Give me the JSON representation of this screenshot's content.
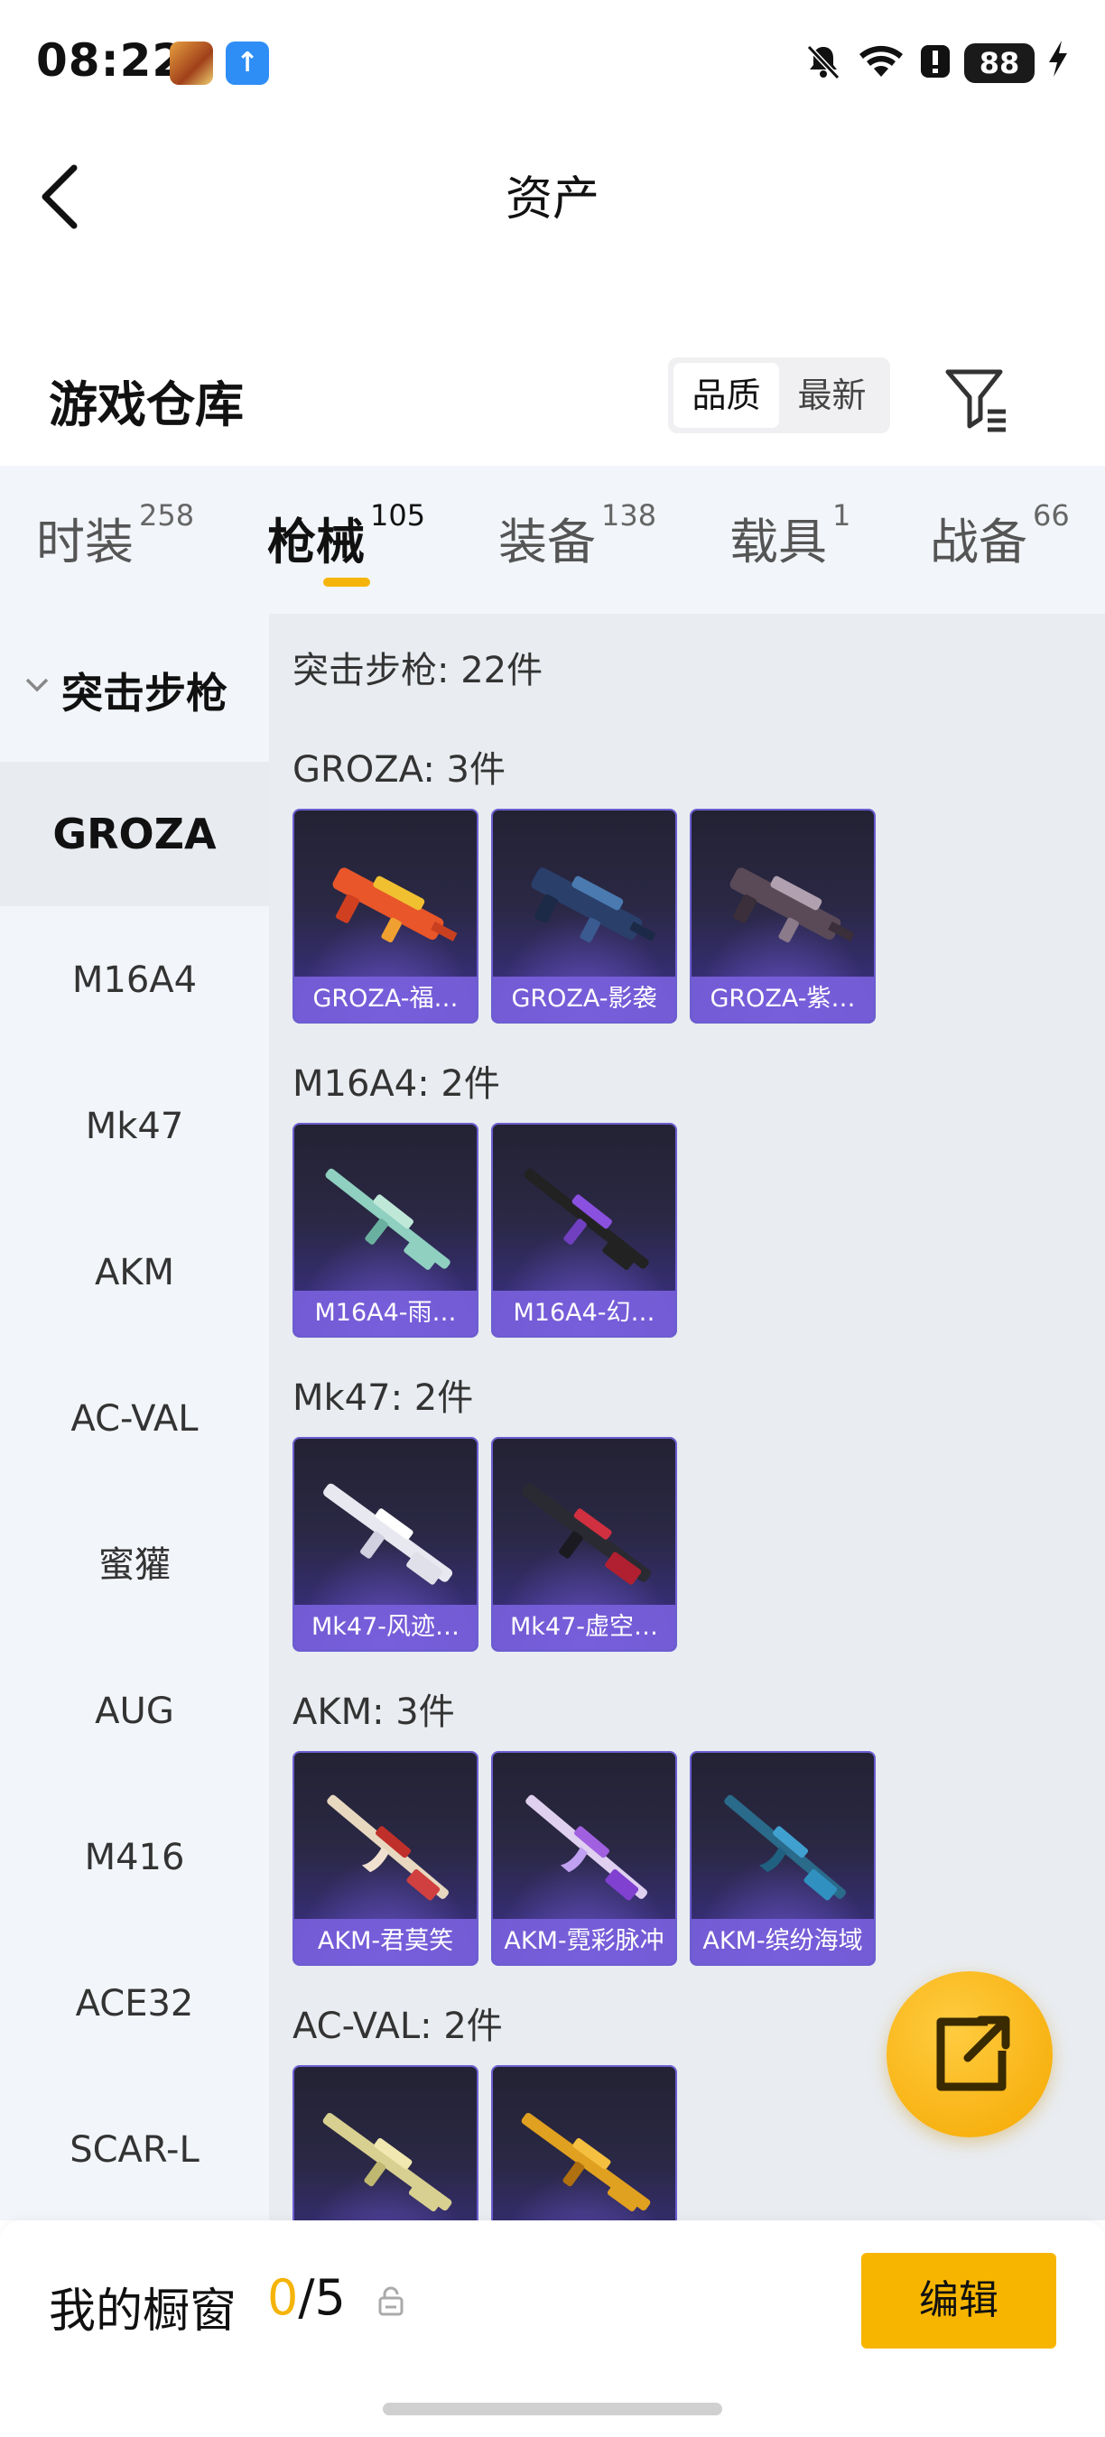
{
  "status_bar": {
    "time": "08:22",
    "battery": "88"
  },
  "header": {
    "title": "资产"
  },
  "warehouse": {
    "title": "游戏仓库",
    "sort_options": [
      {
        "label": "品质",
        "active": true
      },
      {
        "label": "最新",
        "active": false
      }
    ]
  },
  "tabs": [
    {
      "label": "时装",
      "count": "258"
    },
    {
      "label": "枪械",
      "count": "105",
      "active": true
    },
    {
      "label": "装备",
      "count": "138"
    },
    {
      "label": "载具",
      "count": "1"
    },
    {
      "label": "战备",
      "count": "66"
    }
  ],
  "sidebar": {
    "category": "突击步枪",
    "items": [
      "GROZA",
      "M16A4",
      "Mk47",
      "AKM",
      "AC-VAL",
      "蜜獾",
      "AUG",
      "M416",
      "ACE32",
      "SCAR-L"
    ],
    "active": "GROZA"
  },
  "content": {
    "total": "突击步枪: 22件",
    "groups": [
      {
        "title": "GROZA: 3件",
        "items": [
          "GROZA-福…",
          "GROZA-影袭",
          "GROZA-紫…"
        ]
      },
      {
        "title": "M16A4: 2件",
        "items": [
          "M16A4-雨…",
          "M16A4-幻…"
        ]
      },
      {
        "title": "Mk47: 2件",
        "items": [
          "Mk47-风迹…",
          "Mk47-虚空…"
        ]
      },
      {
        "title": "AKM: 3件",
        "items": [
          "AKM-君莫笑",
          "AKM-霓彩脉冲",
          "AKM-缤纷海域"
        ]
      },
      {
        "title": "AC-VAL: 2件",
        "items": [
          "",
          ""
        ]
      }
    ]
  },
  "bottom_bar": {
    "showcase_title": "我的橱窗",
    "used": "0",
    "total": "/5",
    "edit_label": "编辑"
  },
  "colors": {
    "accent": "#f5b40a",
    "card_purple": "#6b5ed0"
  },
  "icons": [
    "back-arrow-icon",
    "filter-icon",
    "chevron-down-icon",
    "share-icon",
    "lock-icon",
    "mute-icon",
    "wifi-icon",
    "alert-icon",
    "battery-icon",
    "bolt-icon"
  ]
}
